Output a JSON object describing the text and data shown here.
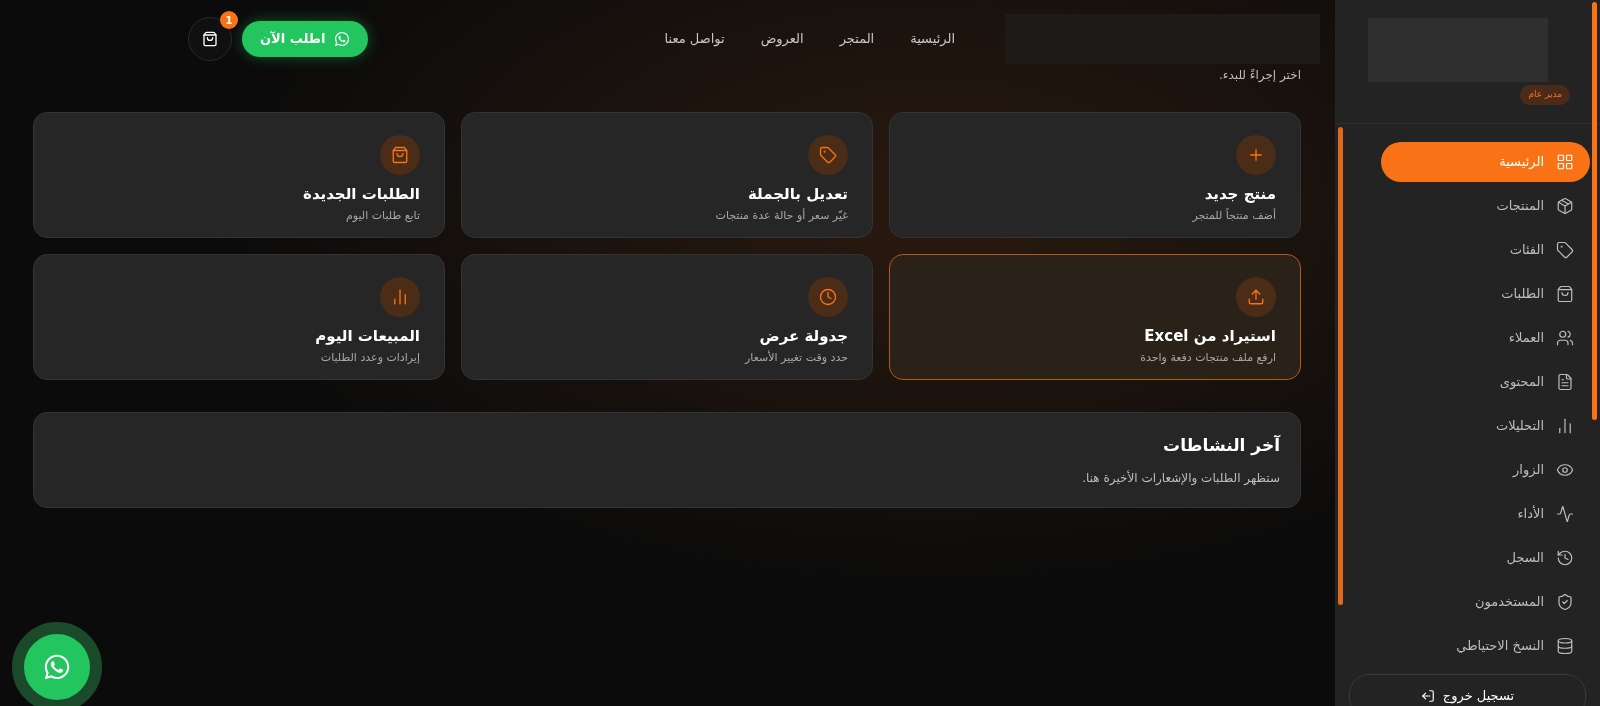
{
  "header": {
    "nav": [
      {
        "label": "الرئيسية"
      },
      {
        "label": "المتجر"
      },
      {
        "label": "العروض"
      },
      {
        "label": "تواصل معنا"
      }
    ],
    "order_button": "اطلب الآن",
    "cart_count": "1"
  },
  "intro": "اختر إجراءً للبدء.",
  "actions": [
    {
      "title": "منتج جديد",
      "subtitle": "أضف منتجاً للمتجر",
      "selected": false
    },
    {
      "title": "تعديل بالجملة",
      "subtitle": "غيّر سعر أو حالة عدة منتجات",
      "selected": false
    },
    {
      "title": "الطلبات الجديدة",
      "subtitle": "تابع طلبات اليوم",
      "selected": false
    },
    {
      "title": "استيراد من Excel",
      "subtitle": "ارفع ملف منتجات دفعة واحدة",
      "selected": true
    },
    {
      "title": "جدولة عرض",
      "subtitle": "حدد وقت تغيير الأسعار",
      "selected": false
    },
    {
      "title": "المبيعات اليوم",
      "subtitle": "إيرادات وعدد الطلبات",
      "selected": false
    }
  ],
  "activity": {
    "title": "آخر النشاطات",
    "text": "ستظهر الطلبات والإشعارات الأخيرة هنا."
  },
  "sidebar": {
    "role": "مدير عام",
    "items": [
      {
        "label": "الرئيسية",
        "selected": true
      },
      {
        "label": "المنتجات",
        "selected": false
      },
      {
        "label": "الفئات",
        "selected": false
      },
      {
        "label": "الطلبات",
        "selected": false
      },
      {
        "label": "العملاء",
        "selected": false
      },
      {
        "label": "المحتوى",
        "selected": false
      },
      {
        "label": "التحليلات",
        "selected": false
      },
      {
        "label": "الزوار",
        "selected": false
      },
      {
        "label": "الأداء",
        "selected": false
      },
      {
        "label": "السجل",
        "selected": false
      },
      {
        "label": "المستخدمون",
        "selected": false
      },
      {
        "label": "النسخ الاحتياطي",
        "selected": false
      }
    ],
    "logout": "تسجيل خروج"
  }
}
